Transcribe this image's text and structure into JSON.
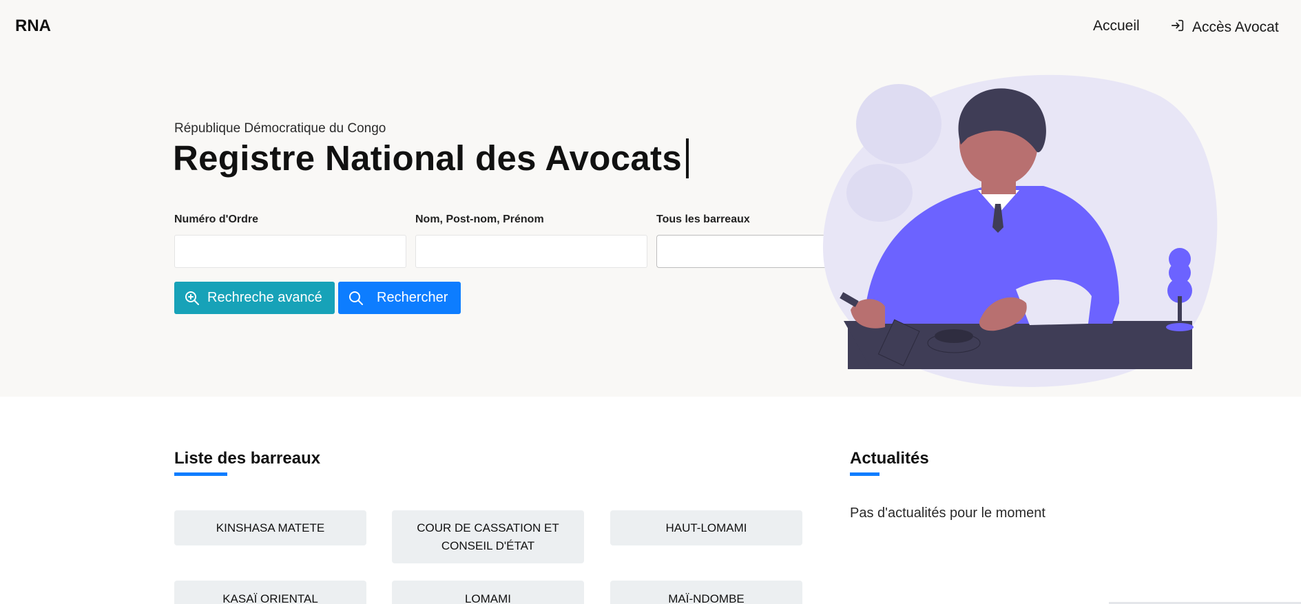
{
  "nav": {
    "brand": "RNA",
    "home": "Accueil",
    "login": "Accès Avocat"
  },
  "hero": {
    "subtitle": "République Démocratique du Congo",
    "title": "Registre National des Avocats",
    "fields": {
      "ordre_label": "Numéro d'Ordre",
      "ordre_value": "",
      "nom_label": "Nom, Post-nom, Prénom",
      "nom_value": "",
      "barreau_label": "Tous les barreaux",
      "barreau_value": ""
    },
    "buttons": {
      "advanced": "Rechreche avancé",
      "search": "Rechercher"
    }
  },
  "barreaux": {
    "title": "Liste des barreaux",
    "items": [
      "KINSHASA MATETE",
      "COUR DE CASSATION ET CONSEIL D'ÉTAT",
      "HAUT-LOMAMI",
      "KASAÏ ORIENTAL",
      "LOMAMI",
      "MAÏ-NDOMBE"
    ]
  },
  "actualites": {
    "title": "Actualités",
    "empty": "Pas d'actualités pour le moment"
  },
  "colors": {
    "primary": "#0d7dff",
    "info": "#17a2b8",
    "illustration_accent": "#6c63ff",
    "hero_bg": "#f9f8f6",
    "card_bg": "#eceff1"
  },
  "icons": [
    "login-icon",
    "zoom-in-icon",
    "search-icon",
    "chevron-down-icon"
  ]
}
